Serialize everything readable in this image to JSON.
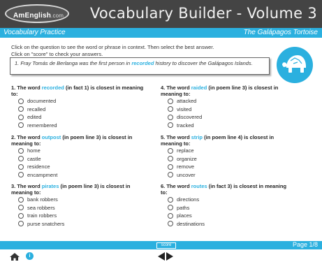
{
  "header": {
    "logo_brand": "AmEnglish",
    "logo_suffix": ".com",
    "title": "Vocabulary Builder - Volume 3"
  },
  "subbar": {
    "section": "Vocabulary Practice",
    "story": "The Galápagos Tortoise"
  },
  "instructions": {
    "line1": "Click on the question to see the word or phrase in context.  Then select the best answer.",
    "line2": "Click on \"score\" to check your answers."
  },
  "fact": {
    "prefix": "1. Fray Tomás de Berlanga was the first person in ",
    "keyword": "recorded",
    "suffix": " history to discover the Galápagos Islands."
  },
  "questions": [
    {
      "title_pre": "1. The word ",
      "keyword": "recorded",
      "title_post": " (in fact 1) is closest in meaning to:",
      "options": [
        "documented",
        "recalled",
        "edited",
        "remembered"
      ]
    },
    {
      "title_pre": "2. The word ",
      "keyword": "outpost",
      "title_post": " (in poem line 3) is closest in meaning to:",
      "options": [
        "home",
        "castle",
        "residence",
        "encampment"
      ]
    },
    {
      "title_pre": "3. The word ",
      "keyword": "pirates",
      "title_post": " (in poem line 3) is closest in meaning to:",
      "options": [
        "bank robbers",
        "sea robbers",
        "train robbers",
        "purse snatchers"
      ]
    },
    {
      "title_pre": "4. The word ",
      "keyword": "raided",
      "title_post": " (in poem line 3) is closest in meaning to:",
      "options": [
        "attacked",
        "visited",
        "discovered",
        "tracked"
      ]
    },
    {
      "title_pre": "5. The word ",
      "keyword": "strip",
      "title_post": " (in poem line 4) is closest in meaning to:",
      "options": [
        "replace",
        "organize",
        "remove",
        "uncover"
      ]
    },
    {
      "title_pre": "6. The word ",
      "keyword": "routes",
      "title_post": " (in fact 3) is closest in meaning to:",
      "options": [
        "directions",
        "paths",
        "places",
        "destinations"
      ]
    }
  ],
  "footer": {
    "score_label": "score",
    "page_label": "Page 1/8"
  },
  "icons": {
    "home": "home-icon",
    "info": "info-icon",
    "prev": "arrow-left-icon",
    "next": "arrow-right-icon",
    "badge": "tortoise-icon"
  },
  "info_glyph": "i",
  "colors": {
    "header_bg": "#444444",
    "accent": "#2bb0df",
    "text": "#222222"
  }
}
